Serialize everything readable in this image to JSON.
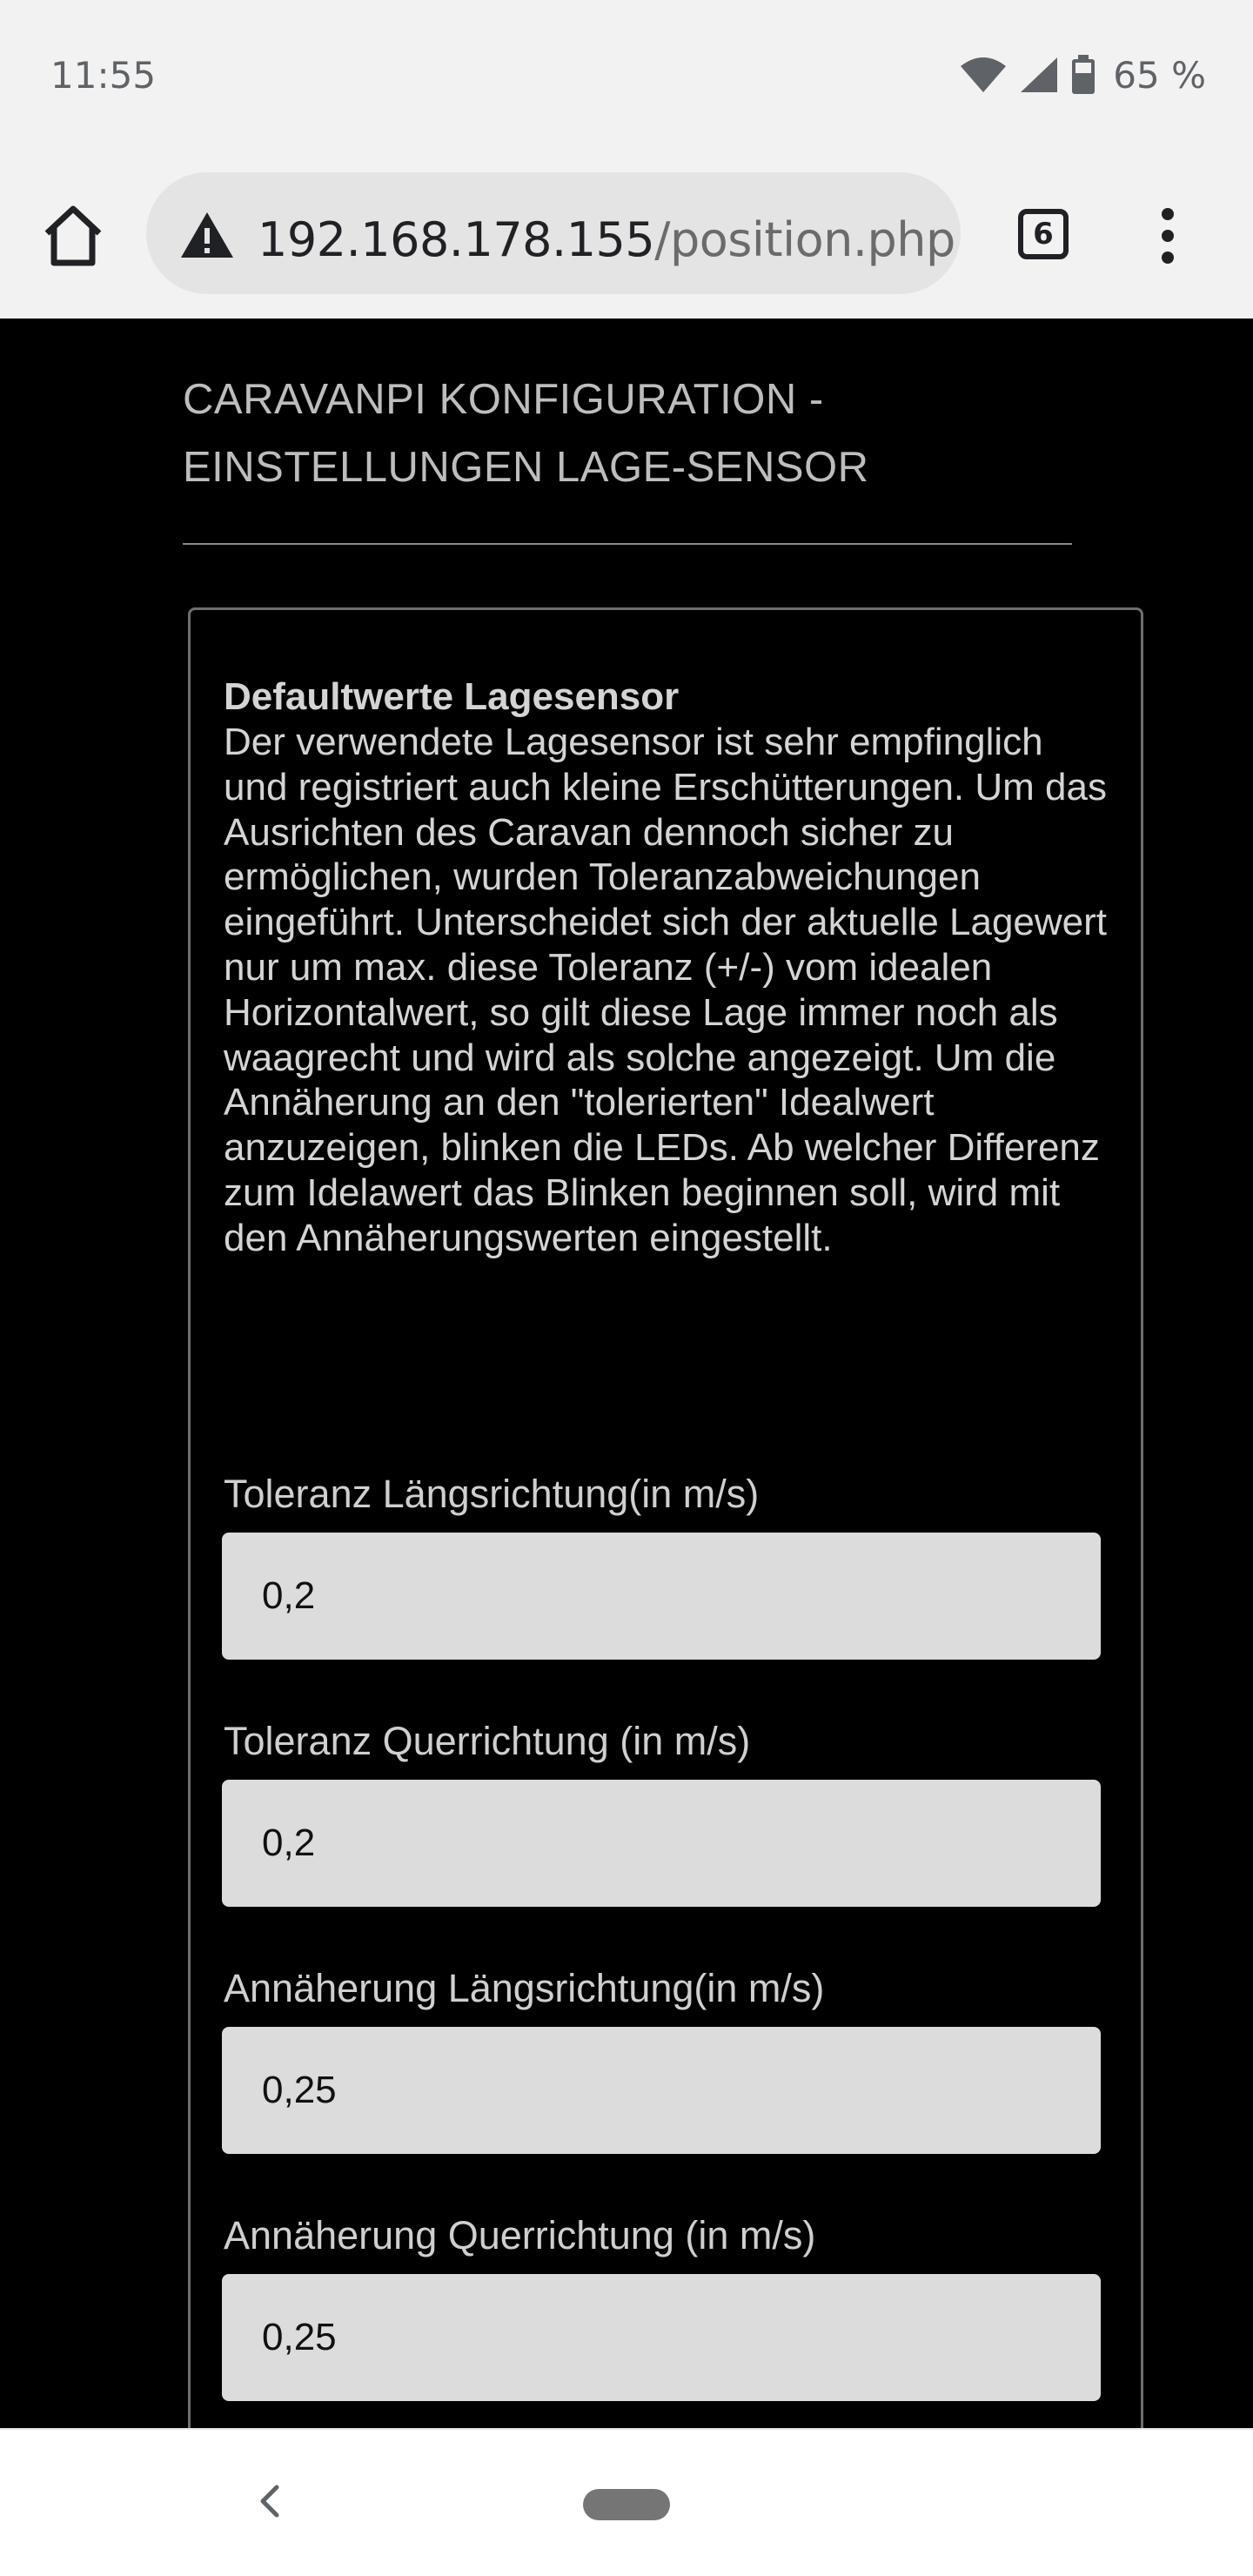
{
  "status_bar": {
    "time": "11:55",
    "battery": "65 %",
    "icons": [
      "wifi-icon",
      "cell-signal-icon",
      "battery-icon"
    ]
  },
  "browser": {
    "url_host": "192.168.178.155",
    "url_path": "/position.php",
    "tab_count": "6",
    "icons": [
      "home-icon",
      "warning-icon",
      "tabs-icon",
      "more-vert-icon"
    ]
  },
  "page": {
    "title": "CARAVANPI KONFIGURATION - EINSTELLUNGEN LAGE-SENSOR",
    "description_heading": "Defaultwerte Lagesensor",
    "description_body": "Der verwendete Lagesensor ist sehr empfinglich und registriert auch kleine Erschütterungen. Um das Ausrichten des Caravan dennoch sicher zu ermöglichen, wurden Toleranzabweichungen eingeführt. Unterscheidet sich der aktuelle Lagewert nur um max. diese Toleranz (+/-) vom idealen Horizontalwert, so gilt diese Lage immer noch als waagrecht und wird als solche angezeigt. Um die Annäherung an den \"tolerierten\" Idealwert anzuzeigen, blinken die LEDs. Ab welcher Differenz zum Idelawert das Blinken beginnen soll, wird mit den Annäherungswerten eingestellt.",
    "fields": [
      {
        "label": "Toleranz Längsrichtung(in m/s)",
        "value": "0,2"
      },
      {
        "label": "Toleranz Querrichtung (in m/s)",
        "value": "0,2"
      },
      {
        "label": "Annäherung Längsrichtung(in m/s)",
        "value": "0,25"
      },
      {
        "label": "Annäherung Querrichtung (in m/s)",
        "value": "0,25"
      }
    ]
  },
  "nav_bar": {
    "icons": [
      "back-icon",
      "home-pill-icon"
    ]
  },
  "colors": {
    "page_background": "#000000",
    "text": "#d4d4d4",
    "input_background": "#dcdcdc",
    "chrome_background": "#f2f2f2"
  }
}
